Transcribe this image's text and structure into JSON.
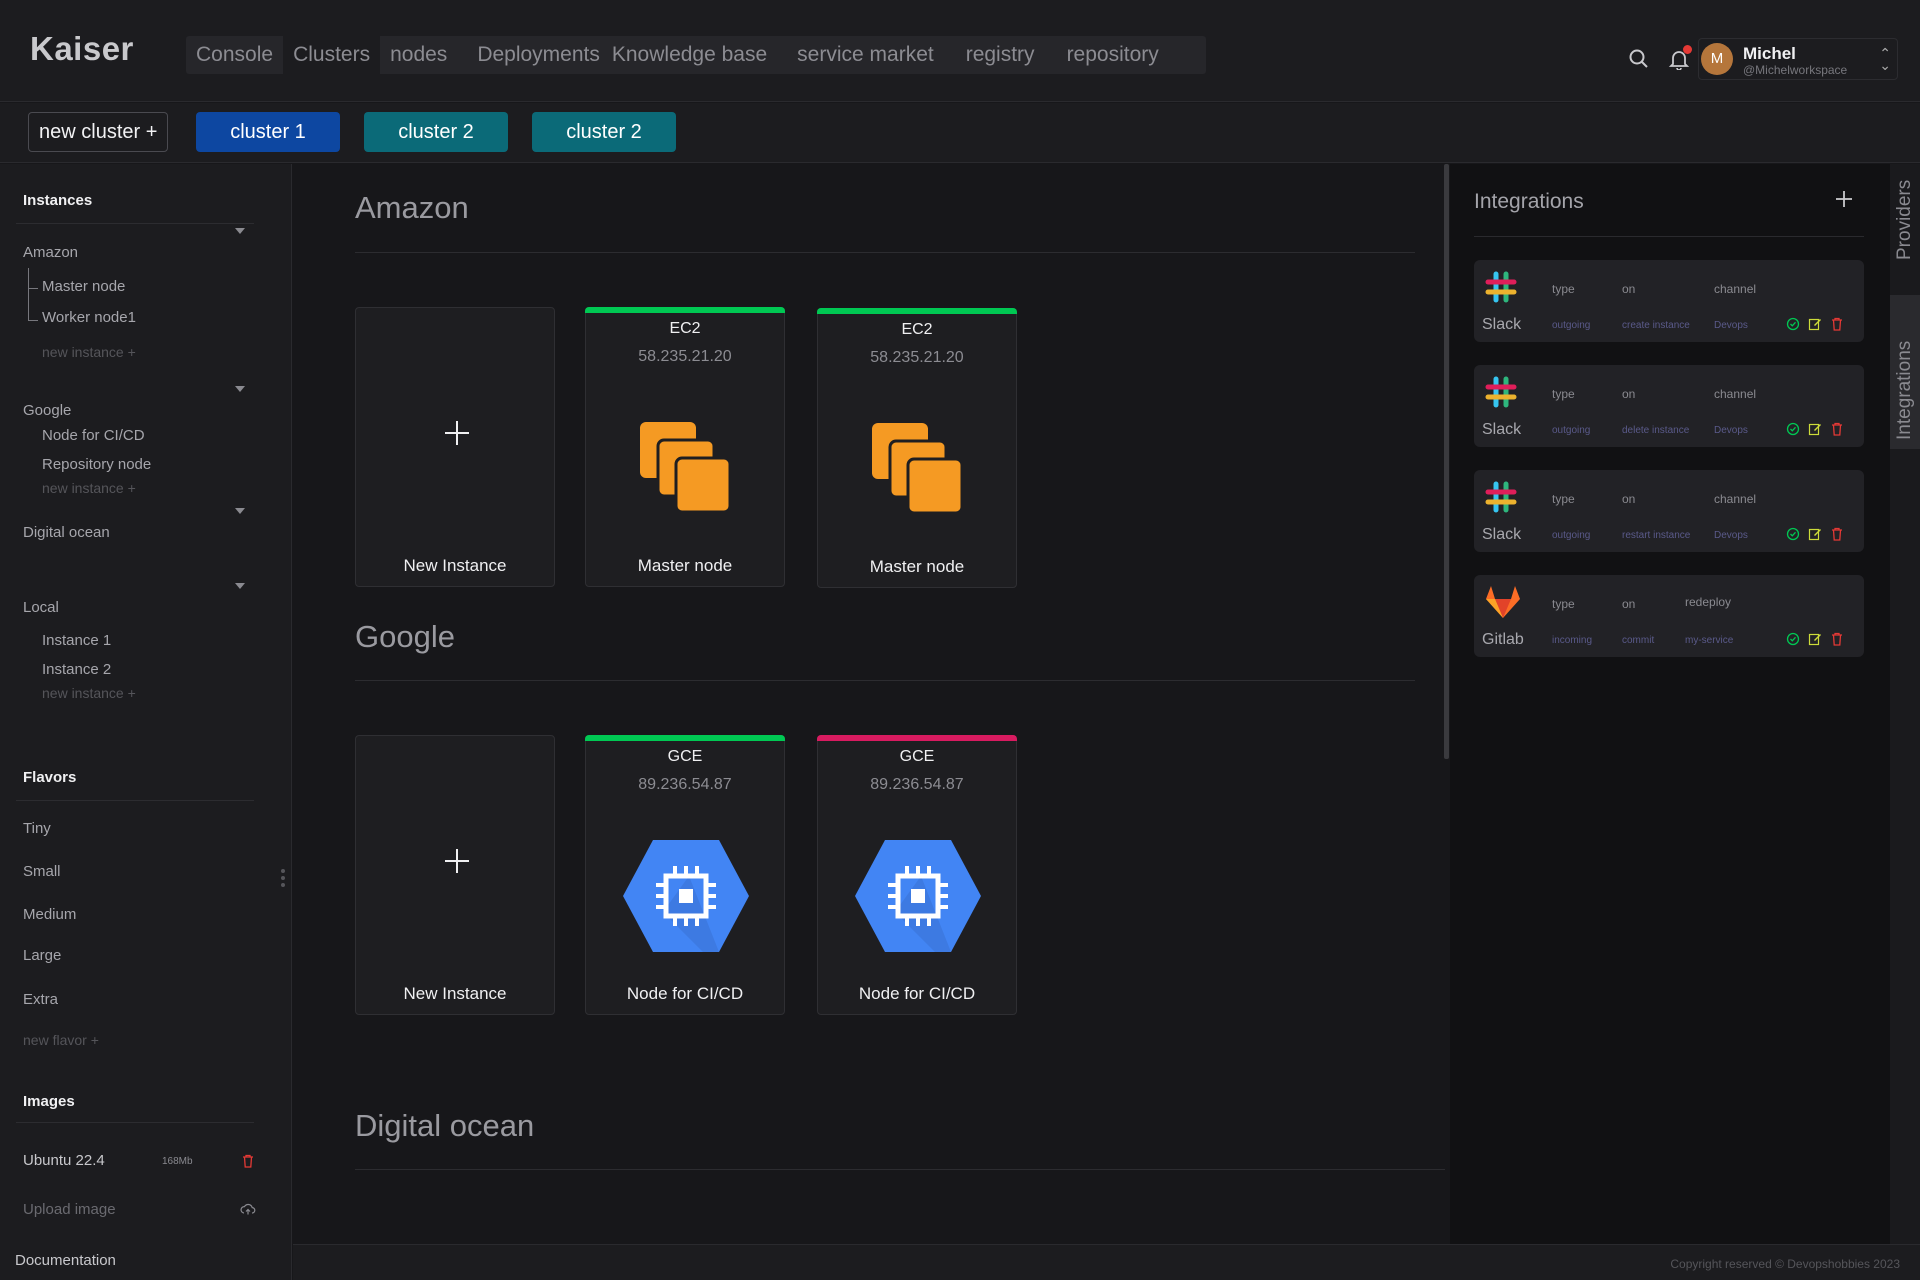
{
  "app": {
    "logo": "Kaiser"
  },
  "nav": [
    "Console",
    "Clusters",
    "nodes",
    "Deployments",
    "Knowledge base",
    "service market",
    "registry",
    "repository"
  ],
  "user": {
    "initial": "M",
    "name": "Michel",
    "workspace": "@Michelworkspace"
  },
  "clusters": {
    "new_label": "new cluster +",
    "tabs": [
      {
        "label": "cluster 1",
        "color": "#0d47a1"
      },
      {
        "label": "cluster 2",
        "color": "#0b6a78"
      },
      {
        "label": "cluster 2",
        "color": "#0b6a78"
      }
    ]
  },
  "sidebar": {
    "instances_heading": "Instances",
    "groups": [
      {
        "name": "Amazon",
        "items": [
          "Master node",
          "Worker node1"
        ],
        "new": "new instance +"
      },
      {
        "name": "Google",
        "items": [
          "Node for CI/CD",
          "Repository node"
        ],
        "new": "new instance +"
      },
      {
        "name": "Digital ocean",
        "items": [],
        "new": ""
      },
      {
        "name": "Local",
        "items": [
          "Instance 1",
          "Instance 2"
        ],
        "new": "new instance +"
      }
    ],
    "flavors_heading": "Flavors",
    "flavors": [
      "Tiny",
      "Small",
      "Medium",
      "Large",
      "Extra"
    ],
    "new_flavor": "new flavor +",
    "images_heading": "Images",
    "image": {
      "name": "Ubuntu 22.4",
      "size": "168Mb"
    },
    "upload": "Upload image",
    "documentation": "Documentation"
  },
  "main": {
    "sections": [
      {
        "title": "Amazon",
        "cards": [
          {
            "kind": "new",
            "label": "New Instance"
          },
          {
            "kind": "ec2",
            "type": "EC2",
            "ip": "58.235.21.20",
            "label": "Master node",
            "status_color": "#00c853"
          },
          {
            "kind": "ec2",
            "type": "EC2",
            "ip": "58.235.21.20",
            "label": "Master node",
            "status_color": "#00c853"
          }
        ]
      },
      {
        "title": "Google",
        "cards": [
          {
            "kind": "new",
            "label": "New Instance"
          },
          {
            "kind": "gce",
            "type": "GCE",
            "ip": "89.236.54.87",
            "label": "Node for CI/CD",
            "status_color": "#00c853"
          },
          {
            "kind": "gce",
            "type": "GCE",
            "ip": "89.236.54.87",
            "label": "Node for CI/CD",
            "status_color": "#d81b60"
          }
        ]
      },
      {
        "title": "Digital ocean",
        "cards": []
      }
    ]
  },
  "integrations": {
    "title": "Integrations",
    "cards": [
      {
        "name": "Slack",
        "h1": "type",
        "h2": "on",
        "h3": "channel",
        "v1": "outgoing",
        "v2": "create instance",
        "v3": "Devops",
        "logo": "slack-icon"
      },
      {
        "name": "Slack",
        "h1": "type",
        "h2": "on",
        "h3": "channel",
        "v1": "outgoing",
        "v2": "delete instance",
        "v3": "Devops",
        "logo": "slack-icon"
      },
      {
        "name": "Slack",
        "h1": "type",
        "h2": "on",
        "h3": "channel",
        "v1": "outgoing",
        "v2": "restart instance",
        "v3": "Devops",
        "logo": "slack-icon"
      },
      {
        "name": "Gitlab",
        "h1": "type",
        "h2": "on",
        "h3": "redeploy",
        "v1": "incoming",
        "v2": "commit",
        "v3": "my-service",
        "logo": "gitlab-icon"
      }
    ]
  },
  "side_tabs": [
    "Providers",
    "Integrations"
  ],
  "footer": {
    "copyright": "Copyright reserved © Devopshobbies 2023"
  }
}
